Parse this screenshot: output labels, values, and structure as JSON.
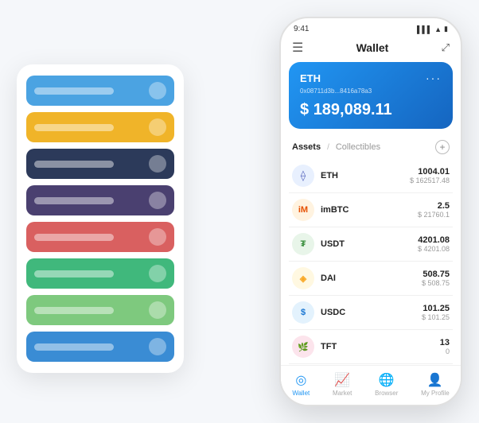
{
  "scene": {
    "background": "#f5f7fa"
  },
  "cardStack": {
    "cards": [
      {
        "color": "c1",
        "bar": true,
        "iconLabel": ""
      },
      {
        "color": "c2",
        "bar": true,
        "iconLabel": ""
      },
      {
        "color": "c3",
        "bar": true,
        "iconLabel": ""
      },
      {
        "color": "c4",
        "bar": true,
        "iconLabel": ""
      },
      {
        "color": "c5",
        "bar": true,
        "iconLabel": ""
      },
      {
        "color": "c6",
        "bar": true,
        "iconLabel": ""
      },
      {
        "color": "c7",
        "bar": true,
        "iconLabel": ""
      },
      {
        "color": "c8",
        "bar": true,
        "iconLabel": ""
      }
    ]
  },
  "phone": {
    "statusBar": {
      "time": "9:41",
      "signal": "●●●",
      "wifi": "WiFi",
      "battery": "🔋"
    },
    "topNav": {
      "menuIcon": "☰",
      "title": "Wallet",
      "expandIcon": "⤢"
    },
    "ethCard": {
      "label": "ETH",
      "dotsMenu": "···",
      "address": "0x08711d3b...8416a78a3",
      "balancePrefix": "$",
      "balance": "189,089.11"
    },
    "assetsSection": {
      "tabActive": "Assets",
      "tabDivider": "/",
      "tabInactive": "Collectibles",
      "addButton": "+"
    },
    "assets": [
      {
        "symbol": "ETH",
        "iconLabel": "⟠",
        "iconClass": "icon-eth",
        "amount": "1004.01",
        "usd": "$ 162517.48"
      },
      {
        "symbol": "imBTC",
        "iconLabel": "🪙",
        "iconClass": "icon-imbtc",
        "amount": "2.5",
        "usd": "$ 21760.1"
      },
      {
        "symbol": "USDT",
        "iconLabel": "₮",
        "iconClass": "icon-usdt",
        "amount": "4201.08",
        "usd": "$ 4201.08"
      },
      {
        "symbol": "DAI",
        "iconLabel": "◈",
        "iconClass": "icon-dai",
        "amount": "508.75",
        "usd": "$ 508.75"
      },
      {
        "symbol": "USDC",
        "iconLabel": "$",
        "iconClass": "icon-usdc",
        "amount": "101.25",
        "usd": "$ 101.25"
      },
      {
        "symbol": "TFT",
        "iconLabel": "🌿",
        "iconClass": "icon-tft",
        "amount": "13",
        "usd": "0"
      }
    ],
    "bottomNav": [
      {
        "label": "Wallet",
        "icon": "◎",
        "active": true
      },
      {
        "label": "Market",
        "icon": "📊",
        "active": false
      },
      {
        "label": "Browser",
        "icon": "👤",
        "active": false
      },
      {
        "label": "My Profile",
        "icon": "👤",
        "active": false
      }
    ]
  }
}
